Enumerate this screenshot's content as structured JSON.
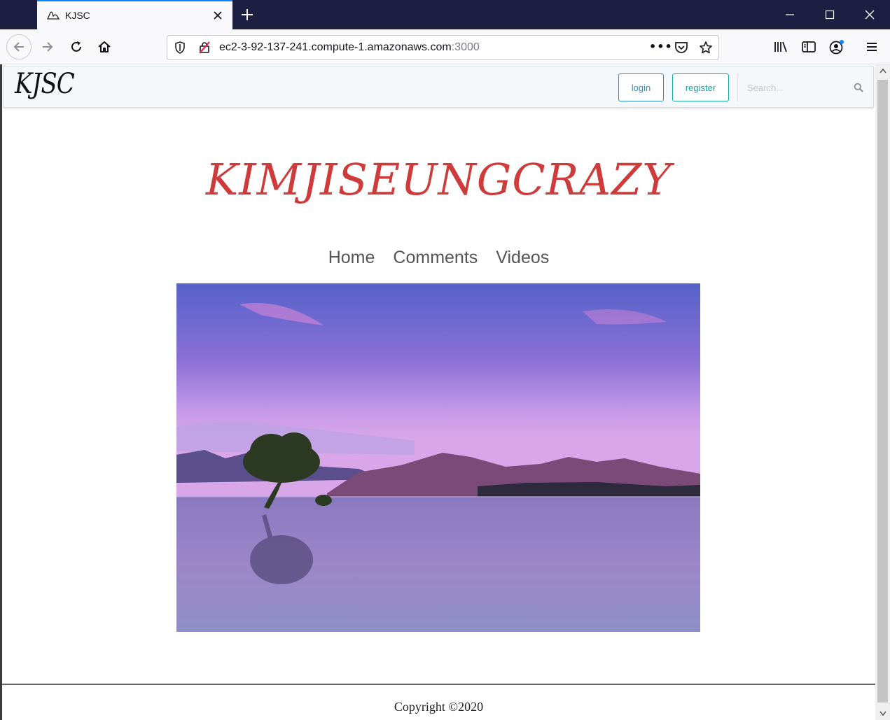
{
  "browser": {
    "tab_title": "KJSC",
    "url_host": "ec2-3-92-137-241.compute-1.amazonaws.com",
    "url_port": ":3000",
    "page_actions_glyph": "•••"
  },
  "site": {
    "brand": "KJSC",
    "login_label": "login",
    "register_label": "register",
    "search_placeholder": "Search...",
    "hero_title": "KIMJISEUNGCRAZY",
    "nav": [
      "Home",
      "Comments",
      "Videos"
    ],
    "copyright": "Copyright ©2020"
  },
  "colors": {
    "hero_red": "#cf3a3a",
    "login_blue": "#2a90c8",
    "register_teal": "#19a7a0",
    "tab_accent": "#0a84ff"
  }
}
